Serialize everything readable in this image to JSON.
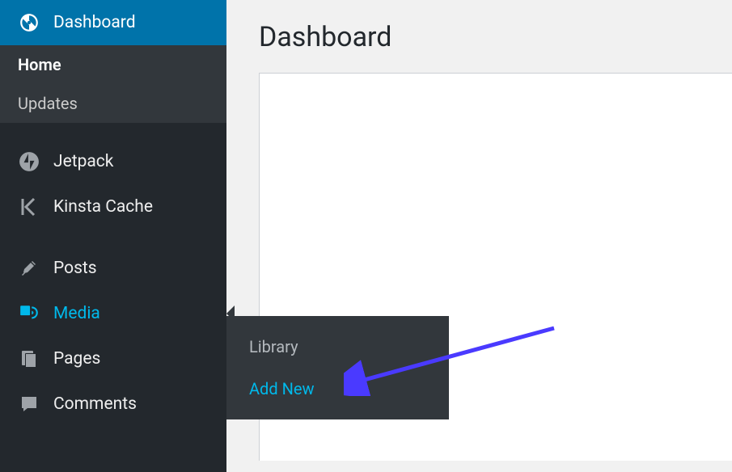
{
  "page": {
    "title": "Dashboard"
  },
  "sidebar": {
    "dashboard": {
      "label": "Dashboard"
    },
    "submenu": {
      "home": "Home",
      "updates": "Updates"
    },
    "jetpack": {
      "label": "Jetpack"
    },
    "kinsta": {
      "label": "Kinsta Cache"
    },
    "posts": {
      "label": "Posts"
    },
    "media": {
      "label": "Media"
    },
    "pages": {
      "label": "Pages"
    },
    "comments": {
      "label": "Comments"
    }
  },
  "flyout": {
    "library": "Library",
    "addnew": "Add New"
  }
}
